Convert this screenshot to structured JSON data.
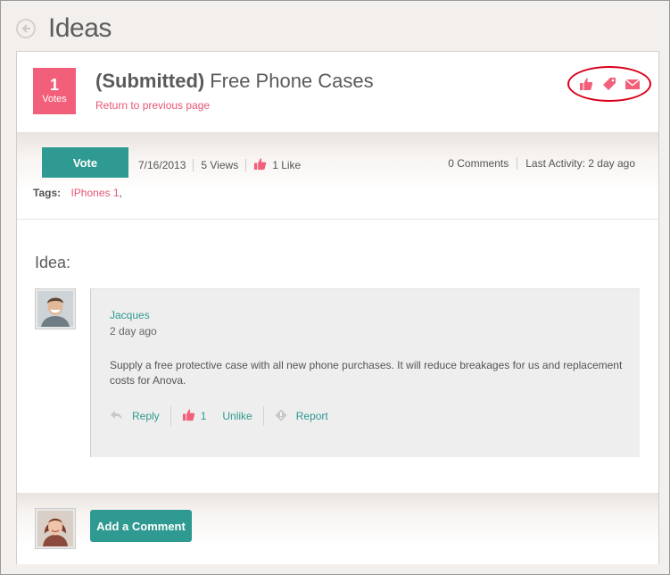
{
  "header": {
    "title": "Ideas",
    "back_icon": "back-arrow-icon"
  },
  "idea": {
    "votes_count": "1",
    "votes_label": "Votes",
    "status": "(Submitted)",
    "title": "Free Phone Cases",
    "return_link": "Return to previous page",
    "actions": [
      "thumbs-up-icon",
      "tag-icon",
      "envelope-icon"
    ]
  },
  "info": {
    "vote_button": "Vote",
    "date": "7/16/2013",
    "views": "5 Views",
    "likes": "1 Like",
    "comments": "0 Comments",
    "last_activity": "Last Activity: 2 day ago",
    "tags_label": "Tags:",
    "tag": "IPhones 1",
    "tag_suffix": ","
  },
  "post": {
    "section_title": "Idea:",
    "author": "Jacques",
    "date": "2 day ago",
    "body": "Supply a free protective case with all new phone purchases. It will reduce breakages for us and replacement costs for Anova.",
    "reply_label": "Reply",
    "like_count": "1",
    "unlike_label": "Unlike",
    "report_label": "Report"
  },
  "footer": {
    "add_comment_button": "Add a Comment"
  },
  "colors": {
    "accent_pink": "#f25f7a",
    "teal": "#2f9a91",
    "highlight_red": "#d9001b"
  }
}
